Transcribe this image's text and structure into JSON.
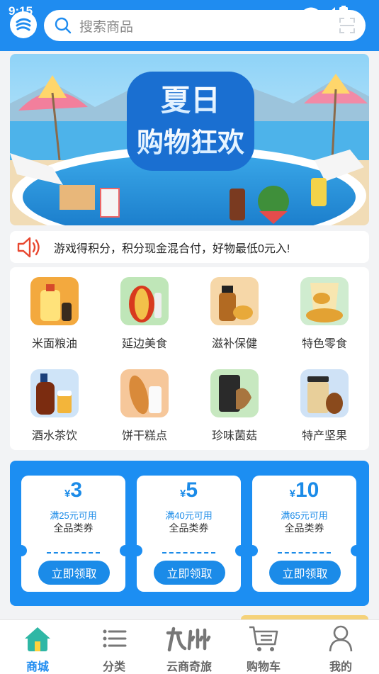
{
  "status": {
    "time": "9:15"
  },
  "search": {
    "placeholder": "搜索商品"
  },
  "banner": {
    "line1": "夏日",
    "line2": "购物狂欢"
  },
  "notice": {
    "text": "游戏得积分，积分现金混合付，好物最低0元入!"
  },
  "categories": [
    {
      "label": "米面粮油",
      "icon": "oil-icon"
    },
    {
      "label": "延边美食",
      "icon": "kimchi-icon"
    },
    {
      "label": "滋补保健",
      "icon": "tonic-icon"
    },
    {
      "label": "特色零食",
      "icon": "snack-icon"
    },
    {
      "label": "酒水茶饮",
      "icon": "drink-icon"
    },
    {
      "label": "饼干糕点",
      "icon": "bread-icon"
    },
    {
      "label": "珍味菌菇",
      "icon": "mushroom-icon"
    },
    {
      "label": "特产坚果",
      "icon": "nut-icon"
    }
  ],
  "coupons": [
    {
      "currency": "¥",
      "amount": "3",
      "condition": "满25元可用",
      "type": "全品类券",
      "button": "立即领取"
    },
    {
      "currency": "¥",
      "amount": "5",
      "condition": "满40元可用",
      "type": "全品类券",
      "button": "立即领取"
    },
    {
      "currency": "¥",
      "amount": "10",
      "condition": "满65元可用",
      "type": "全品类券",
      "button": "立即领取"
    }
  ],
  "nav": [
    {
      "label": "商城",
      "icon": "home-icon",
      "active": true
    },
    {
      "label": "分类",
      "icon": "list-icon"
    },
    {
      "label": "云商奇旅",
      "icon": "jiuzhou-icon"
    },
    {
      "label": "购物车",
      "icon": "cart-icon"
    },
    {
      "label": "我的",
      "icon": "profile-icon"
    }
  ],
  "colors": {
    "primary": "#1f8cf0",
    "coupon_text": "#1b8be8",
    "notice_icon": "#e8472f"
  }
}
